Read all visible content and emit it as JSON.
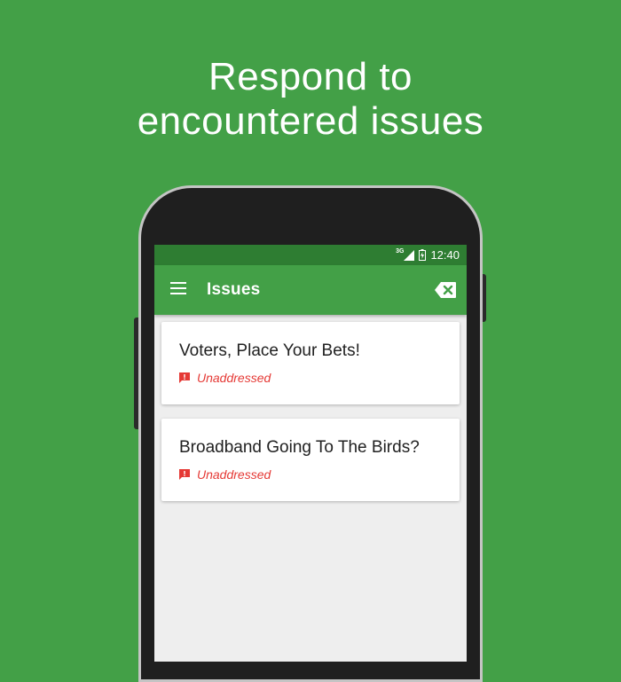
{
  "headline": {
    "line1": "Respond to",
    "line2": "encountered issues"
  },
  "statusbar": {
    "network": "3G",
    "time": "12:40"
  },
  "appbar": {
    "title": "Issues"
  },
  "issues": [
    {
      "title": "Voters, Place Your Bets!",
      "status": "Unaddressed"
    },
    {
      "title": "Broadband Going To The Birds?",
      "status": "Unaddressed"
    }
  ],
  "colors": {
    "background": "#43a047",
    "statusbar": "#2e7d32",
    "appbar": "#43a047",
    "status_unaddressed": "#e53935"
  },
  "icons": {
    "menu": "menu-icon",
    "clear": "backspace-icon",
    "status": "feedback-icon",
    "signal": "signal-icon",
    "battery": "battery-icon"
  }
}
